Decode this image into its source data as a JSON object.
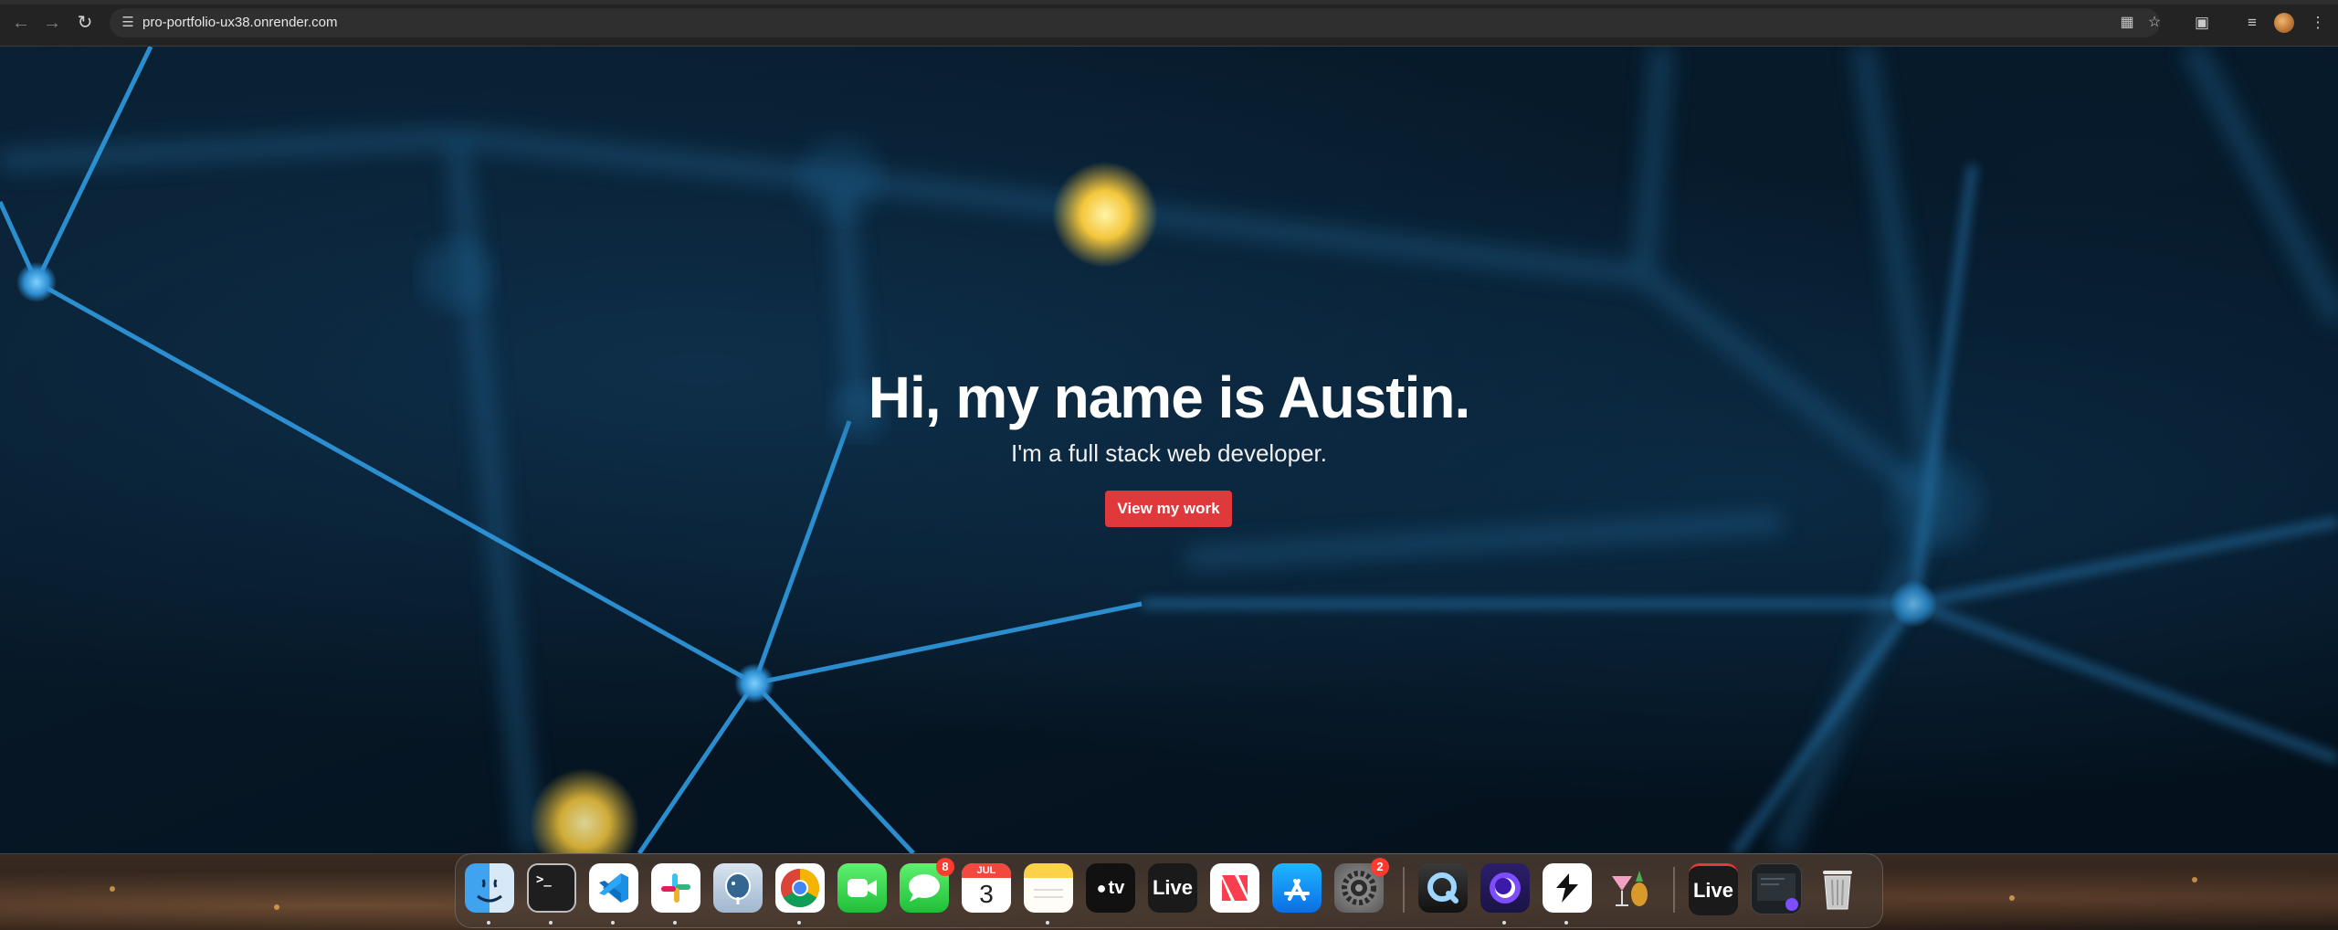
{
  "browser": {
    "url": "pro-portfolio-ux38.onrender.com",
    "nav": {
      "back_icon": "arrow-left-icon",
      "forward_icon": "arrow-right-icon",
      "reload_icon": "reload-icon"
    },
    "omnibox_icons": [
      "translate-icon",
      "bookmark-star-icon"
    ],
    "toolbar_icons": [
      "extensions-icon",
      "media-controls-icon",
      "profile-avatar",
      "menu-kebab-icon"
    ]
  },
  "hero": {
    "title": "Hi, my name is Austin.",
    "subtitle": "I'm a full stack web developer.",
    "cta_label": "View my work",
    "accent_color": "#e0393b"
  },
  "dock": {
    "apps": [
      {
        "name": "Finder",
        "icon": "finder-icon",
        "running": true
      },
      {
        "name": "Terminal",
        "icon": "terminal-icon",
        "running": true
      },
      {
        "name": "Visual Studio Code",
        "icon": "vscode-icon",
        "running": true
      },
      {
        "name": "Slack",
        "icon": "slack-icon",
        "running": true
      },
      {
        "name": "PostgreSQL",
        "icon": "postgres-icon",
        "running": false
      },
      {
        "name": "Google Chrome",
        "icon": "chrome-icon",
        "running": true
      },
      {
        "name": "FaceTime",
        "icon": "facetime-icon",
        "running": false
      },
      {
        "name": "Messages",
        "icon": "messages-icon",
        "running": false,
        "badge": "8"
      },
      {
        "name": "Calendar",
        "icon": "calendar-icon",
        "running": false,
        "month": "JUL",
        "day": "3"
      },
      {
        "name": "Notes",
        "icon": "notes-icon",
        "running": true
      },
      {
        "name": "Apple TV",
        "icon": "appletv-icon",
        "running": false,
        "label": "tv"
      },
      {
        "name": "Ableton Live",
        "icon": "live-icon",
        "running": false,
        "label": "Live"
      },
      {
        "name": "News",
        "icon": "news-icon",
        "running": false
      },
      {
        "name": "App Store",
        "icon": "appstore-icon",
        "running": false
      },
      {
        "name": "System Settings",
        "icon": "settings-icon",
        "running": false,
        "badge": "2"
      },
      {
        "name": "QuickTime",
        "icon": "quicktime-icon",
        "running": false
      },
      {
        "name": "Tor Browser",
        "icon": "tor-icon",
        "running": true
      },
      {
        "name": "Shortcuts",
        "icon": "shortcuts-icon",
        "running": true
      },
      {
        "name": "Cocktail",
        "icon": "cocktail-icon",
        "running": false
      }
    ],
    "recent": [
      {
        "name": "Live",
        "icon": "live-icon",
        "label": "Live"
      },
      {
        "name": "Window Preview",
        "icon": "window-preview-icon"
      },
      {
        "name": "Trash",
        "icon": "trash-icon"
      }
    ]
  }
}
